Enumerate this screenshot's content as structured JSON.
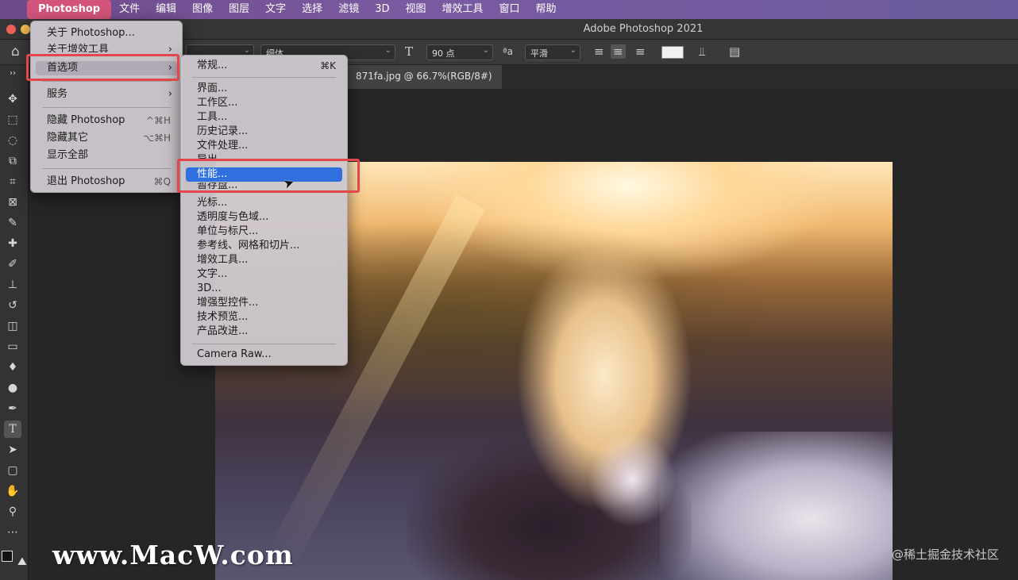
{
  "menubar": {
    "apple_icon": "apple-icon",
    "items": [
      "Photoshop",
      "文件",
      "编辑",
      "图像",
      "图层",
      "文字",
      "选择",
      "滤镜",
      "3D",
      "视图",
      "增效工具",
      "窗口",
      "帮助"
    ]
  },
  "window": {
    "title": "Adobe Photoshop 2021"
  },
  "options": {
    "font_style": "细体",
    "font_size": "90 点",
    "antialias": "平滑",
    "aa_icon": "ªa"
  },
  "document": {
    "tab_label": "871fa.jpg @ 66.7%(RGB/8#)"
  },
  "app_menu": {
    "about": "关于 Photoshop...",
    "about_plugins": "关于增效工具",
    "preferences": "首选项",
    "services": "服务",
    "hide": "隐藏 Photoshop",
    "hide_shortcut": "^⌘H",
    "hide_others": "隐藏其它",
    "hide_others_shortcut": "⌥⌘H",
    "show_all": "显示全部",
    "quit": "退出 Photoshop",
    "quit_shortcut": "⌘Q"
  },
  "prefs_menu": {
    "general": "常规...",
    "general_shortcut": "⌘K",
    "items": [
      "界面...",
      "工作区...",
      "工具...",
      "历史记录...",
      "文件处理...",
      "导出...",
      "性能...",
      "暂存盘...",
      "光标...",
      "透明度与色域...",
      "单位与标尺...",
      "参考线、网格和切片...",
      "增效工具...",
      "文字...",
      "3D...",
      "增强型控件...",
      "技术预览...",
      "产品改进..."
    ],
    "camera_raw": "Camera Raw...",
    "selected": "性能..."
  },
  "watermarks": {
    "left": "www.MacW.com",
    "right": "@稀土掘金技术社区"
  },
  "colors": {
    "accent": "#2f6fde",
    "highlight_box": "#e2474c",
    "app_menu_bg": "#d2547a"
  }
}
